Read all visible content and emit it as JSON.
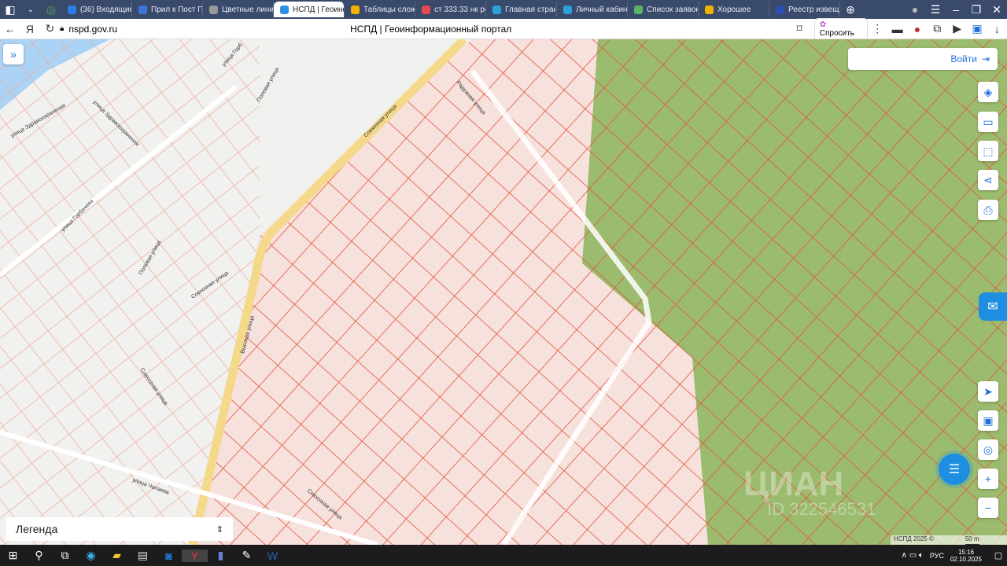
{
  "browser": {
    "tabs": [
      {
        "label": "(36) Входящие",
        "color": "#2d7be5"
      },
      {
        "label": "Прил к Пост П",
        "color": "#3a78d6"
      },
      {
        "label": "Цветные линии",
        "color": "#999"
      },
      {
        "label": "НСПД | Геоинформ",
        "color": "#2f8fe0",
        "active": true
      },
      {
        "label": "Таблицы сложе",
        "color": "#f0b400"
      },
      {
        "label": "ст 333.33 нк рф",
        "color": "#e54b4b"
      },
      {
        "label": "Главная стран",
        "color": "#2aa1d8"
      },
      {
        "label": "Личный кабин",
        "color": "#2aa1d8"
      },
      {
        "label": "Список заявок",
        "color": "#59b36b"
      },
      {
        "label": "Хорошее",
        "color": "#f0b400"
      },
      {
        "label": "Реестр извещ",
        "color": "#2d4fb0"
      }
    ],
    "url": "nspd.gov.ru",
    "page_title": "НСПД | Геоинформационный портал",
    "ask_label": "Спросить"
  },
  "map": {
    "login_label": "Войти",
    "legend_label": "Легенда",
    "copyright": "НСПД 2025 ©",
    "scale": "50 m",
    "watermark": "ЦИАН",
    "watermark_id": "ID 322546531",
    "streets": [
      "улица Здравоохранения",
      "улица Здравоохранения",
      "улица Горбачева",
      "Полевая улица",
      "Полевая улица",
      "Совхозная улица",
      "Совхозная улица",
      "Совхозная улица",
      "Совхозная улица",
      "Высокая улица",
      "Радужная улица",
      "улица Чапаева",
      "улица Горб"
    ],
    "colors": {
      "parcel_fill": "#f7e1dc",
      "parcel_line": "#e2553c",
      "forest": "#9bbb6e",
      "road": "#f5d98a",
      "accent": "#1e6fd9"
    }
  },
  "taskbar": {
    "lang": "РУС",
    "time": "15:16",
    "date": "02.10.2025"
  }
}
